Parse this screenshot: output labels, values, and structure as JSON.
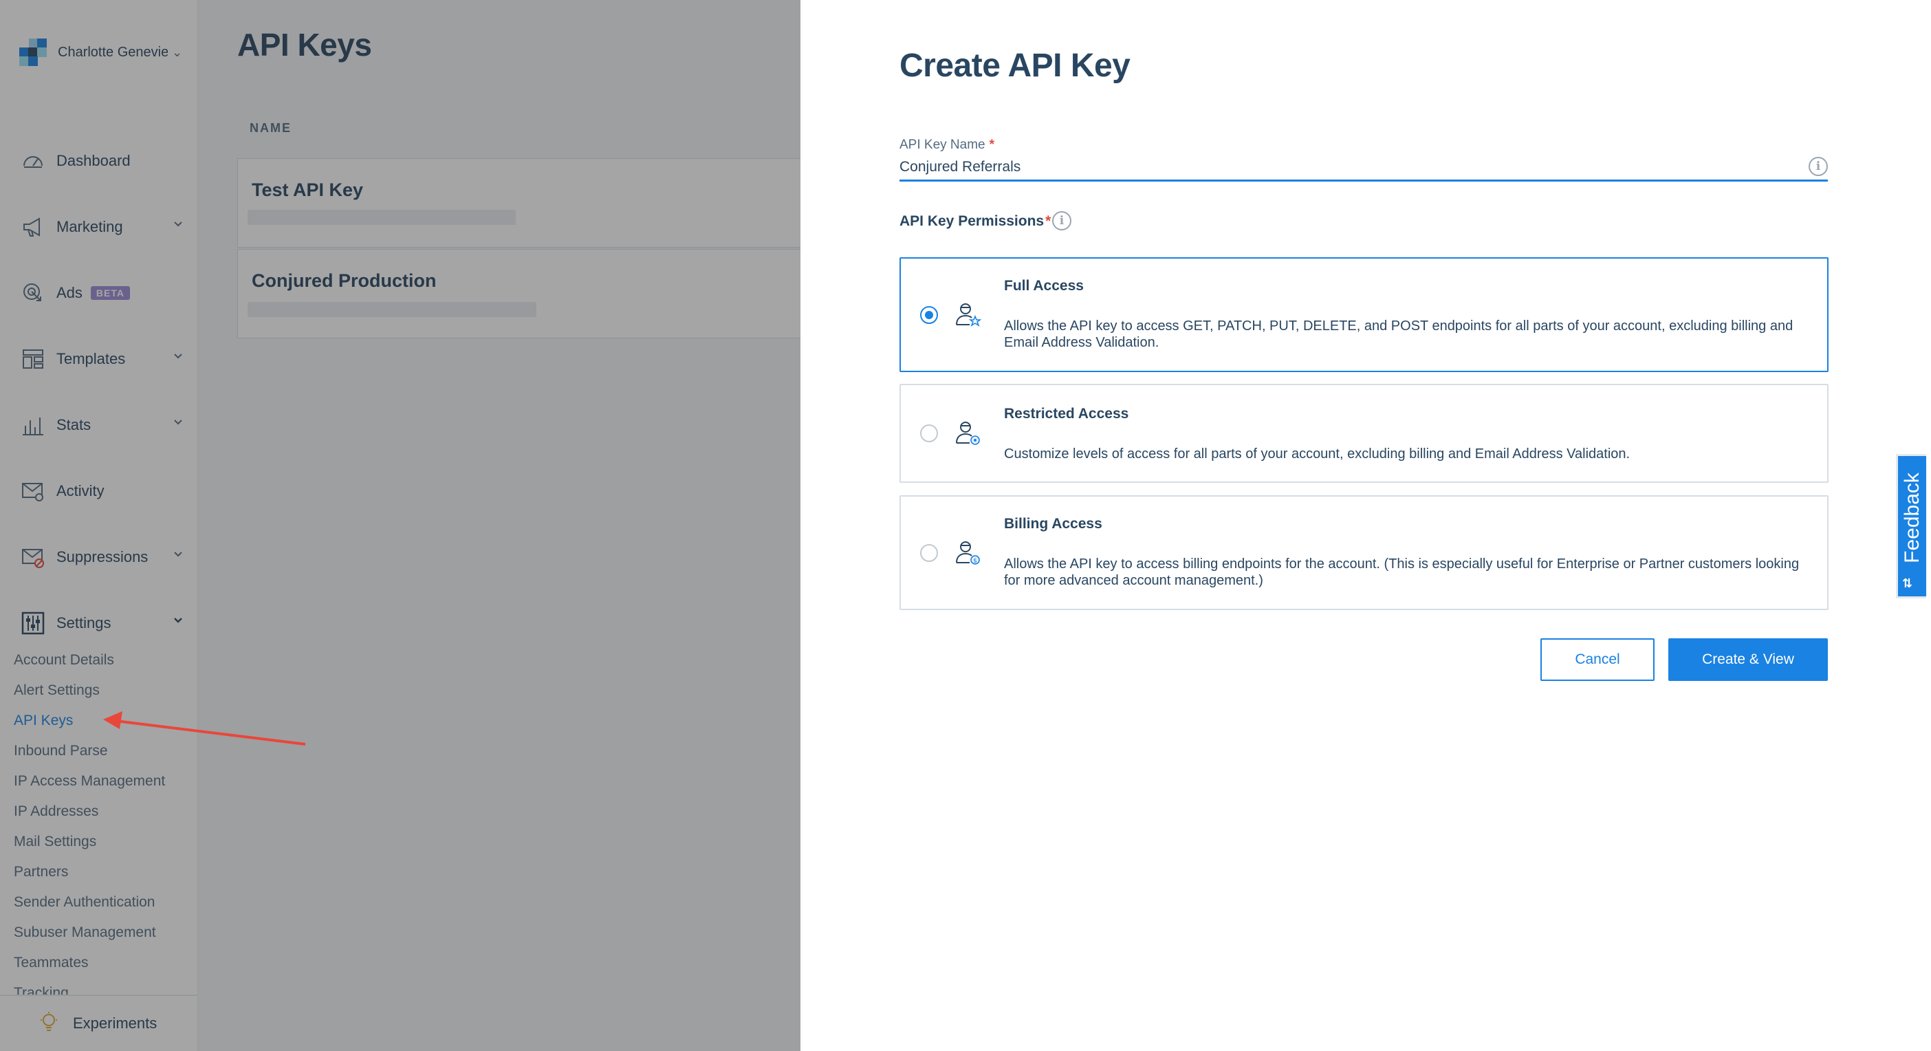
{
  "account": {
    "name": "Charlotte Genevie"
  },
  "nav": {
    "items": [
      {
        "label": "Dashboard",
        "icon": "dashboard-icon",
        "expandable": false
      },
      {
        "label": "Marketing",
        "icon": "megaphone-icon",
        "expandable": true
      },
      {
        "label": "Ads",
        "icon": "target-icon",
        "expandable": false,
        "badge": "BETA"
      },
      {
        "label": "Templates",
        "icon": "templates-icon",
        "expandable": true
      },
      {
        "label": "Stats",
        "icon": "stats-icon",
        "expandable": true
      },
      {
        "label": "Activity",
        "icon": "mail-search-icon",
        "expandable": false
      },
      {
        "label": "Suppressions",
        "icon": "mail-block-icon",
        "expandable": true
      },
      {
        "label": "Settings",
        "icon": "settings-sliders-icon",
        "expandable": true
      }
    ],
    "settings_sub": [
      "Account Details",
      "Alert Settings",
      "API Keys",
      "Inbound Parse",
      "IP Access Management",
      "IP Addresses",
      "Mail Settings",
      "Partners",
      "Sender Authentication",
      "Subuser Management",
      "Teammates",
      "Tracking"
    ],
    "active_sub": "API Keys",
    "experiments": "Experiments"
  },
  "page": {
    "title": "API Keys",
    "column_name": "NAME",
    "keys": [
      {
        "name": "Test API Key"
      },
      {
        "name": "Conjured Production"
      }
    ]
  },
  "drawer": {
    "title": "Create API Key",
    "name_label": "API Key Name",
    "name_value": "Conjured Referrals",
    "required_mark": "*",
    "permissions_label": "API Key Permissions",
    "options": [
      {
        "title": "Full Access",
        "description": "Allows the API key to access GET, PATCH, PUT, DELETE, and POST endpoints for all parts of your account, excluding billing and Email Address Validation.",
        "selected": true
      },
      {
        "title": "Restricted Access",
        "description": "Customize levels of access for all parts of your account, excluding billing and Email Address Validation.",
        "selected": false
      },
      {
        "title": "Billing Access",
        "description": "Allows the API key to access billing endpoints for the account. (This is especially useful for Enterprise or Partner customers looking for more advanced account management.)",
        "selected": false
      }
    ],
    "cancel_label": "Cancel",
    "create_label": "Create & View"
  },
  "feedback": {
    "label": "Feedback"
  },
  "colors": {
    "accent": "#1a82e2",
    "text": "#294661",
    "muted": "#546b81",
    "annotation_arrow": "#e8473b",
    "beta_badge": "#9a8bd6"
  }
}
